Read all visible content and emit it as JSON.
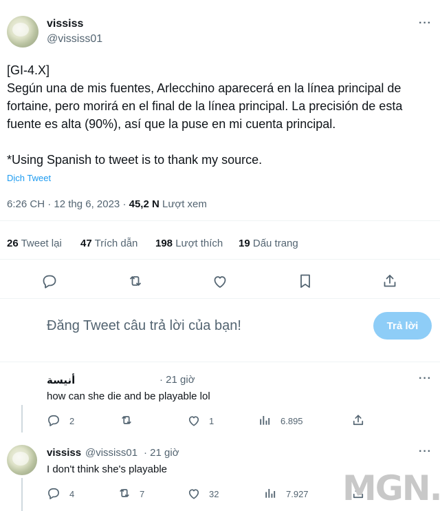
{
  "tweet": {
    "display_name": "vississ",
    "handle": "@vississ01",
    "more_icon": "more-dots-icon",
    "text_line1": "[GI-4.X]",
    "text_line2": "Según una de mis fuentes, Arlecchino aparecerá en la línea principal de",
    "text_line3": "fortaine, pero morirá en el final de la línea principal. La precisión de esta",
    "text_line4": "fuente es alta (90%), así que la puse en mi cuenta principal.",
    "text_line5": "*Using Spanish to tweet is to thank my source.",
    "translate_label": "Dịch Tweet",
    "time": "6:26 CH · 12 thg 6, 2023 · ",
    "views_count": "45,2 N",
    "views_label": " Lượt xem"
  },
  "stats": {
    "retweets_count": "26",
    "retweets_label": " Tweet lại",
    "quotes_count": "47",
    "quotes_label": " Trích dẫn",
    "likes_count": "198",
    "likes_label": " Lượt thích",
    "bookmarks_count": "19",
    "bookmarks_label": " Dấu trang"
  },
  "actions": [
    "reply-icon",
    "retweet-icon",
    "like-icon",
    "bookmark-icon",
    "share-icon"
  ],
  "composer": {
    "prompt": "Đăng Tweet câu trả lời của bạn!",
    "button_label": "Trả lời"
  },
  "replies": [
    {
      "display_name": "أنيسة",
      "meta": "· 21 giờ",
      "text": "how can she die and be playable lol",
      "reply_count": "2",
      "retweet_count": "",
      "like_count": "1",
      "view_count": "6.895"
    },
    {
      "display_name": "vississ",
      "handle": "@vississ01",
      "meta": "· 21 giờ",
      "text": "I don't think she's playable",
      "reply_count": "4",
      "retweet_count": "7",
      "like_count": "32",
      "view_count": "7.927"
    }
  ],
  "watermark": "MGN.",
  "colors": {
    "accent": "#1d9bf0",
    "reply_button": "#8ecdf7",
    "secondary_text": "#536471",
    "divider": "#eff3f4"
  }
}
